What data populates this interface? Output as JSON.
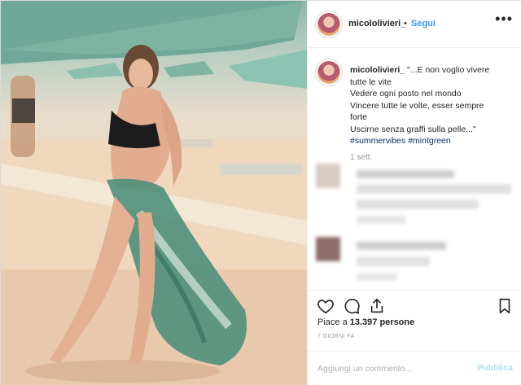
{
  "post": {
    "author": {
      "username": "micololivieri_",
      "dot": "•",
      "follow_label": "Segui"
    },
    "more_icon": "more-horizontal-icon",
    "caption": {
      "username": "micololivieri_",
      "lines": [
        "\"...E non voglio vivere",
        "tutte le vite",
        "Vedere ogni posto nel mondo",
        "Vincere tutte le volte, esser sempre",
        "forte",
        "Uscirne senza graffi sulla pelle...\""
      ],
      "hashtags": "#summervibes #mintgreen",
      "time": "1 sett."
    },
    "actions": {
      "like_icon": "heart-icon",
      "comment_icon": "comment-bubble-icon",
      "share_icon": "share-upload-icon",
      "save_icon": "bookmark-icon"
    },
    "likes": {
      "prefix": "Piace a ",
      "count": "13.397 persone"
    },
    "timestamp": "7 GIORNI FA",
    "comment_box": {
      "placeholder": "Aggiungi un commento...",
      "publish_label": "Pubblica"
    }
  },
  "colors": {
    "link_blue": "#3897f0",
    "hashtag_blue": "#003569",
    "publish_disabled": "#b2dffc",
    "border": "#efefef"
  }
}
